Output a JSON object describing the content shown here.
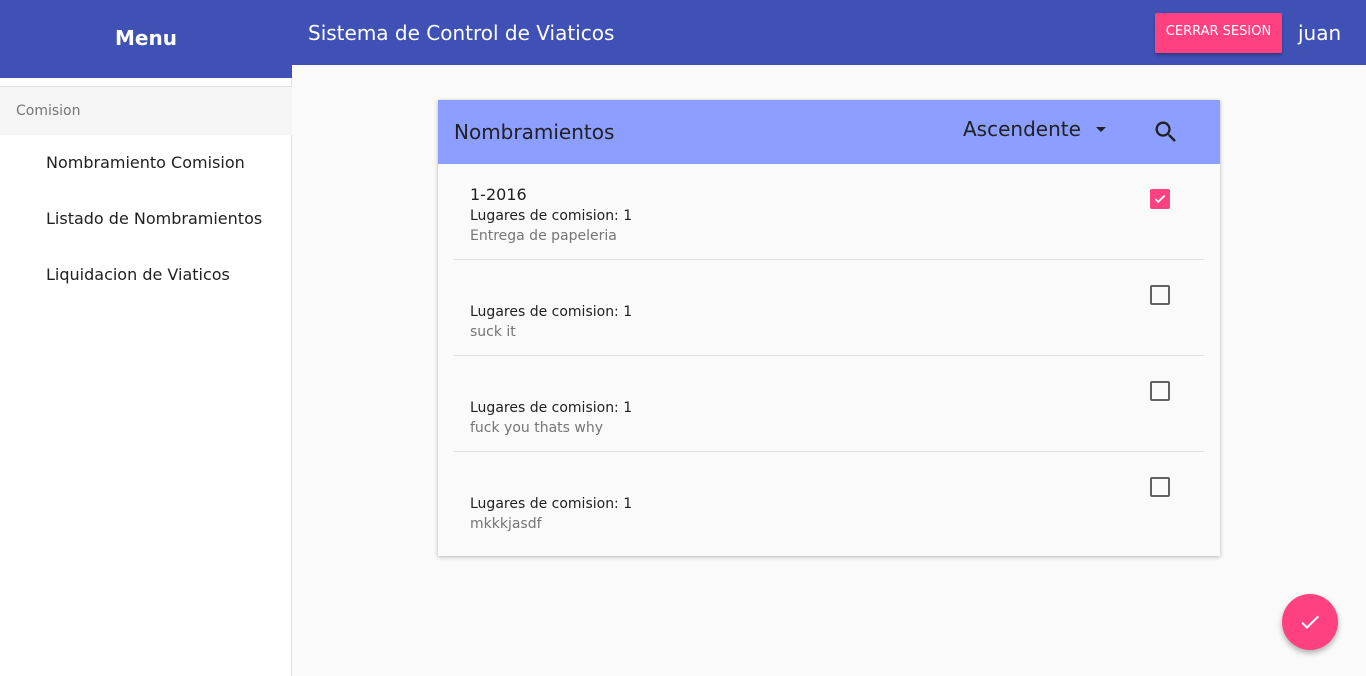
{
  "sidebar": {
    "header": "Menu",
    "section": "Comision",
    "items": [
      {
        "label": "Nombramiento Comision"
      },
      {
        "label": "Listado de Nombramientos"
      },
      {
        "label": "Liquidacion de Viaticos"
      }
    ]
  },
  "topbar": {
    "title": "Sistema de Control de Viaticos",
    "logout_label": "CERRAR SESION",
    "username": "juan"
  },
  "card": {
    "title": "Nombramientos",
    "sort_value": "Ascendente",
    "items": [
      {
        "title": "1-2016",
        "places": "Lugares de comision: 1",
        "description": "Entrega de papeleria",
        "checked": true
      },
      {
        "title": "",
        "places": "Lugares de comision: 1",
        "description": "suck it",
        "checked": false
      },
      {
        "title": "",
        "places": "Lugares de comision: 1",
        "description": "fuck you thats why",
        "checked": false
      },
      {
        "title": "",
        "places": "Lugares de comision: 1",
        "description": "mkkkjasdf",
        "checked": false
      }
    ]
  },
  "icons": {
    "search": "search-icon",
    "dropdown": "arrow-drop-down-icon",
    "fab": "check-icon",
    "checkbox": "check-icon"
  },
  "colors": {
    "primary": "#3f51b5",
    "accent": "#ff4081",
    "card_header": "#8c9eff"
  }
}
